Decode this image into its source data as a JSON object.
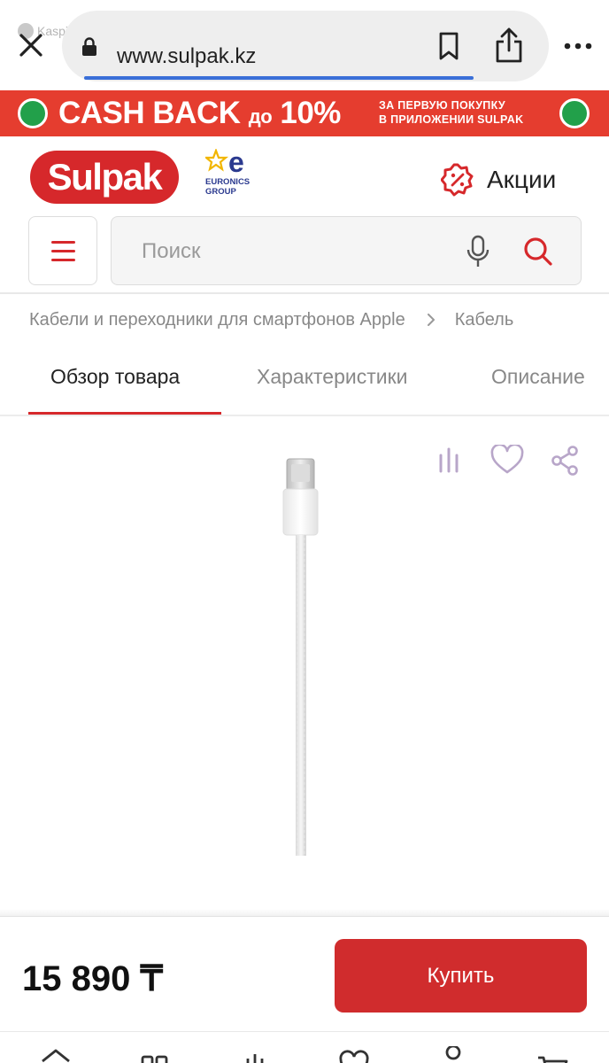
{
  "browser": {
    "back_app_label": "Kaspi.kz",
    "url": "www.sulpak.kz"
  },
  "banner": {
    "main_text": "CASH BACK",
    "prefix": "до",
    "percent": "10%",
    "line1": "ЗА ПЕРВУЮ ПОКУПКУ",
    "line2": "В ПРИЛОЖЕНИИ SULPAK"
  },
  "header": {
    "logo_text": "Sulpak",
    "partner_line1": "EURONICS",
    "partner_line2": "GROUP",
    "promo_label": "Акции"
  },
  "search": {
    "placeholder": "Поиск"
  },
  "breadcrumb": {
    "items": [
      "Кабели и переходники для смартфонов Apple",
      "Кабель"
    ]
  },
  "tabs": [
    {
      "label": "Обзор товара",
      "active": true
    },
    {
      "label": "Характеристики",
      "active": false
    },
    {
      "label": "Описание",
      "active": false
    }
  ],
  "product": {
    "price": "15 890 ₸",
    "buy_label": "Купить"
  },
  "colors": {
    "brand_red": "#d6282b",
    "banner_red": "#e53d2f",
    "banner_green": "#22a04a",
    "icon_lilac": "#b8a6c9"
  }
}
